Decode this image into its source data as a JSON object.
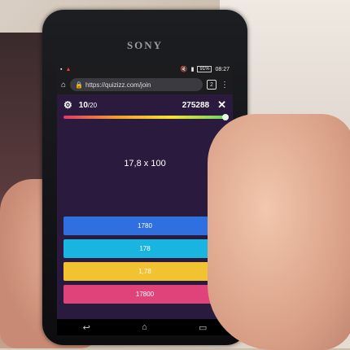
{
  "device": {
    "brand": "SONY"
  },
  "status_bar": {
    "battery": "91%",
    "time": "08:27"
  },
  "browser": {
    "url": "https://quizizz.com/join",
    "tab_count": "2"
  },
  "quiz": {
    "question_number": "10",
    "question_total": "/20",
    "score": "275288",
    "question": "17,8 x 100",
    "answers": [
      {
        "label": "1780",
        "color": "#2f6fe0"
      },
      {
        "label": "178",
        "color": "#19b5e0"
      },
      {
        "label": "1,78",
        "color": "#f1c232"
      },
      {
        "label": "17800",
        "color": "#e0427a"
      }
    ]
  }
}
